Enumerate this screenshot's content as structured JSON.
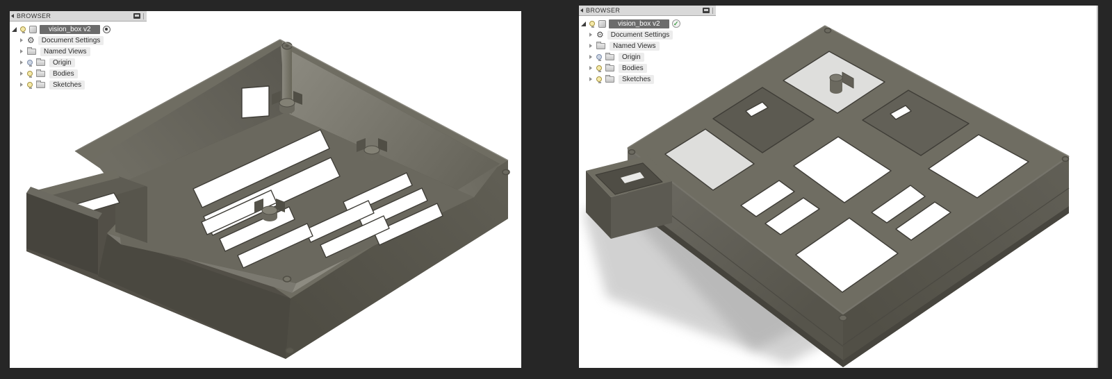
{
  "colors": {
    "background": "#262626",
    "viewport": "#ffffff",
    "panel_header": "#d9d9d9",
    "panel_header_border": "#a9a9a9",
    "row_pill": "#ececec",
    "root_pill": "#6c6c6c",
    "text": "#2b2b2b",
    "model_top": "#6f6d62",
    "model_floor": "#6a685e",
    "model_edge": "#3f3d37",
    "slot_white": "#ffffff",
    "slot_dim": "#dededc",
    "model_inner_dark": "#5e5c53",
    "shadow": "#a5a5a5",
    "bulb_on": "#f5e9a8",
    "bulb_off": "#ccd5e3",
    "check_green": "#3f9b46"
  },
  "left_panel": {
    "title": "BROWSER",
    "header_icon": "display-icon",
    "root_trailing_icon": "activate-radio-icon",
    "rows": [
      {
        "label": "vision_box v2"
      },
      {
        "label": "Document Settings"
      },
      {
        "label": "Named Views"
      },
      {
        "label": "Origin"
      },
      {
        "label": "Bodies"
      },
      {
        "label": "Sketches"
      }
    ]
  },
  "right_panel": {
    "title": "BROWSER",
    "header_icon": "display-icon",
    "root_trailing_icon": "saved-check-icon",
    "check_glyph": "✓",
    "rows": [
      {
        "label": "vision_box v2"
      },
      {
        "label": "Document Settings"
      },
      {
        "label": "Named Views"
      },
      {
        "label": "Origin"
      },
      {
        "label": "Bodies"
      },
      {
        "label": "Sketches"
      }
    ]
  },
  "model": {
    "name": "vision_box v2",
    "left_view": "isometric top view of open slotted enclosure",
    "right_view": "isometric bottom view of ribbed enclosure with ground shadow"
  }
}
